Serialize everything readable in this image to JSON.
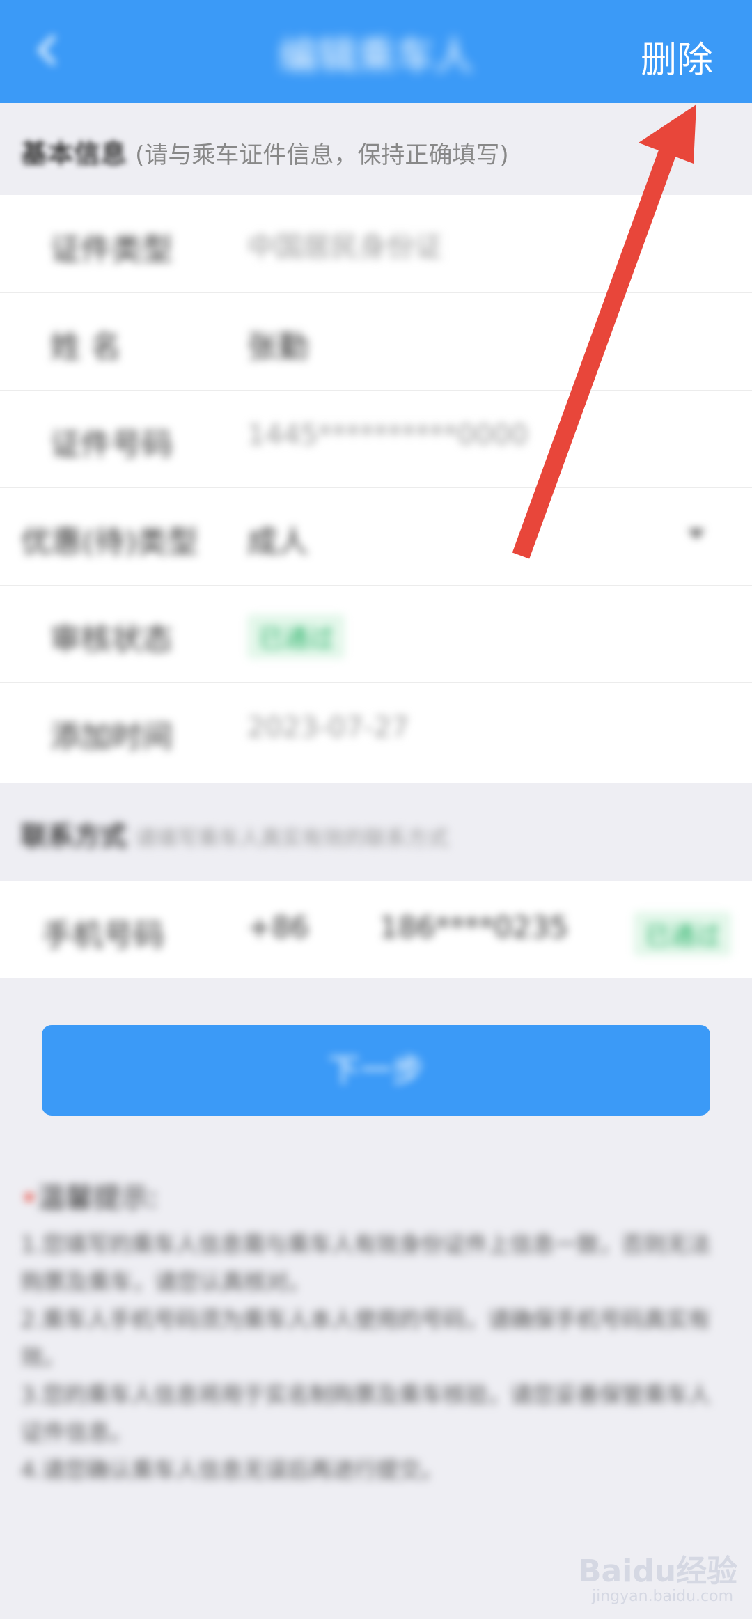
{
  "header": {
    "title": "编辑乘车人",
    "delete_label": "删除"
  },
  "basic_section": {
    "title": "基本信息",
    "subtitle": "(请与乘车证件信息，保持正确填写)"
  },
  "rows": [
    {
      "label": "证件类型",
      "value": "中国居民身份证"
    },
    {
      "label": "姓 名",
      "value": "张勤"
    },
    {
      "label": "证件号码",
      "value": "1445**********0000"
    },
    {
      "label": "优惠(待)类型",
      "value": "成人"
    },
    {
      "label": "审核状态",
      "value": "已通过"
    },
    {
      "label": "添加时间",
      "value": "2023-07-27"
    }
  ],
  "contact_section": {
    "title": "联系方式",
    "subtitle": "请填写乘车人真实有效的联系方式"
  },
  "phone_row": {
    "label": "手机号码",
    "code": "+86",
    "number": "186****0235",
    "status": "已通过"
  },
  "next_button": "下一步",
  "tips": {
    "title": "温馨提示:",
    "lines": [
      "1.您填写的乘车人信息需与乘车人有效身份证件上信息一致，否则无法购票及乘车，请您认真核对。",
      "2.乘车人手机号码须为乘车人本人使用的号码，请确保手机号码真实有效。",
      "3.您的乘车人信息将用于实名制购票及乘车核验，请您妥善保管乘车人证件信息。",
      "4.请您确认乘车人信息无误后再进行提交。"
    ]
  },
  "watermark": {
    "brand": "Baidu经验",
    "url": "jingyan.baidu.com"
  },
  "colors": {
    "header": "#3b9af7",
    "arrow": "#e8463a",
    "badge_bg": "#e3f7ea",
    "badge_text": "#2db36b"
  }
}
